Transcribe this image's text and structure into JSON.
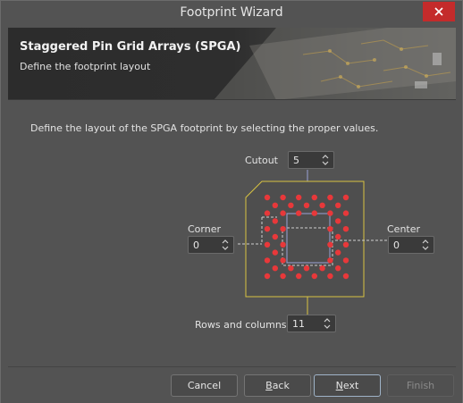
{
  "window": {
    "title": "Footprint Wizard"
  },
  "banner": {
    "title": "Staggered Pin Grid Arrays (SPGA)",
    "subtitle": "Define the footprint layout"
  },
  "instruction": "Define the layout of the SPGA footprint by selecting the proper values.",
  "fields": {
    "cutout": {
      "label": "Cutout",
      "value": "5"
    },
    "corner": {
      "label": "Corner",
      "value": "0"
    },
    "center": {
      "label": "Center",
      "value": "0"
    },
    "rows_columns": {
      "label": "Rows and columns",
      "value": "11"
    }
  },
  "buttons": {
    "cancel": "Cancel",
    "back_hotkey": "B",
    "back_rest": "ack",
    "next_hotkey": "N",
    "next_rest": "ext",
    "finish": "Finish"
  },
  "colors": {
    "close": "#c42b2b",
    "pad": "#e8383a",
    "outline": "#d8c341",
    "cutout_line": "#9aa2d6"
  },
  "icons": {
    "close": "close-icon",
    "spin": "spin-arrows-icon"
  }
}
